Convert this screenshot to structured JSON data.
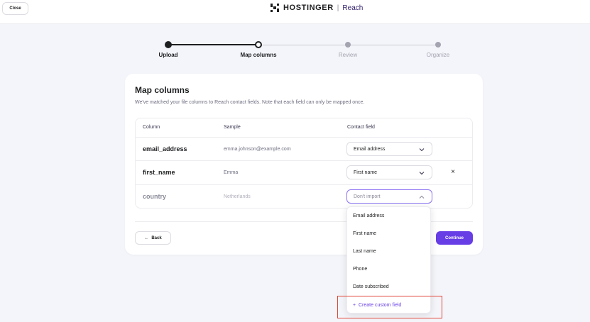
{
  "topbar": {
    "close_label": "Close",
    "brand_name": "HOSTINGER",
    "brand_separator": "|",
    "brand_product": "Reach"
  },
  "stepper": {
    "steps": [
      {
        "label": "Upload",
        "state": "done"
      },
      {
        "label": "Map columns",
        "state": "current"
      },
      {
        "label": "Review",
        "state": "upcoming"
      },
      {
        "label": "Organize",
        "state": "upcoming"
      }
    ]
  },
  "card": {
    "title": "Map columns",
    "description": "We've matched your file columns to Reach contact fields. Note that each field can only be mapped once.",
    "headers": {
      "column": "Column",
      "sample": "Sample",
      "contact_field": "Contact field"
    },
    "rows": [
      {
        "column": "email_address",
        "sample": "emma.johnson@example.com",
        "field": "Email address"
      },
      {
        "column": "first_name",
        "sample": "Emma",
        "field": "First name",
        "remove": "×"
      },
      {
        "column": "country",
        "sample": "Netherlands",
        "field": "Don't import"
      }
    ],
    "back_label": "Back",
    "back_arrow": "←",
    "continue_label": "Continue"
  },
  "dropdown": {
    "options": [
      "Email address",
      "First name",
      "Last name",
      "Phone",
      "Date subscribed"
    ],
    "create_icon": "+",
    "create_label": "Create custom field"
  },
  "colors": {
    "accent": "#673de6",
    "highlight": "#e0473a"
  }
}
